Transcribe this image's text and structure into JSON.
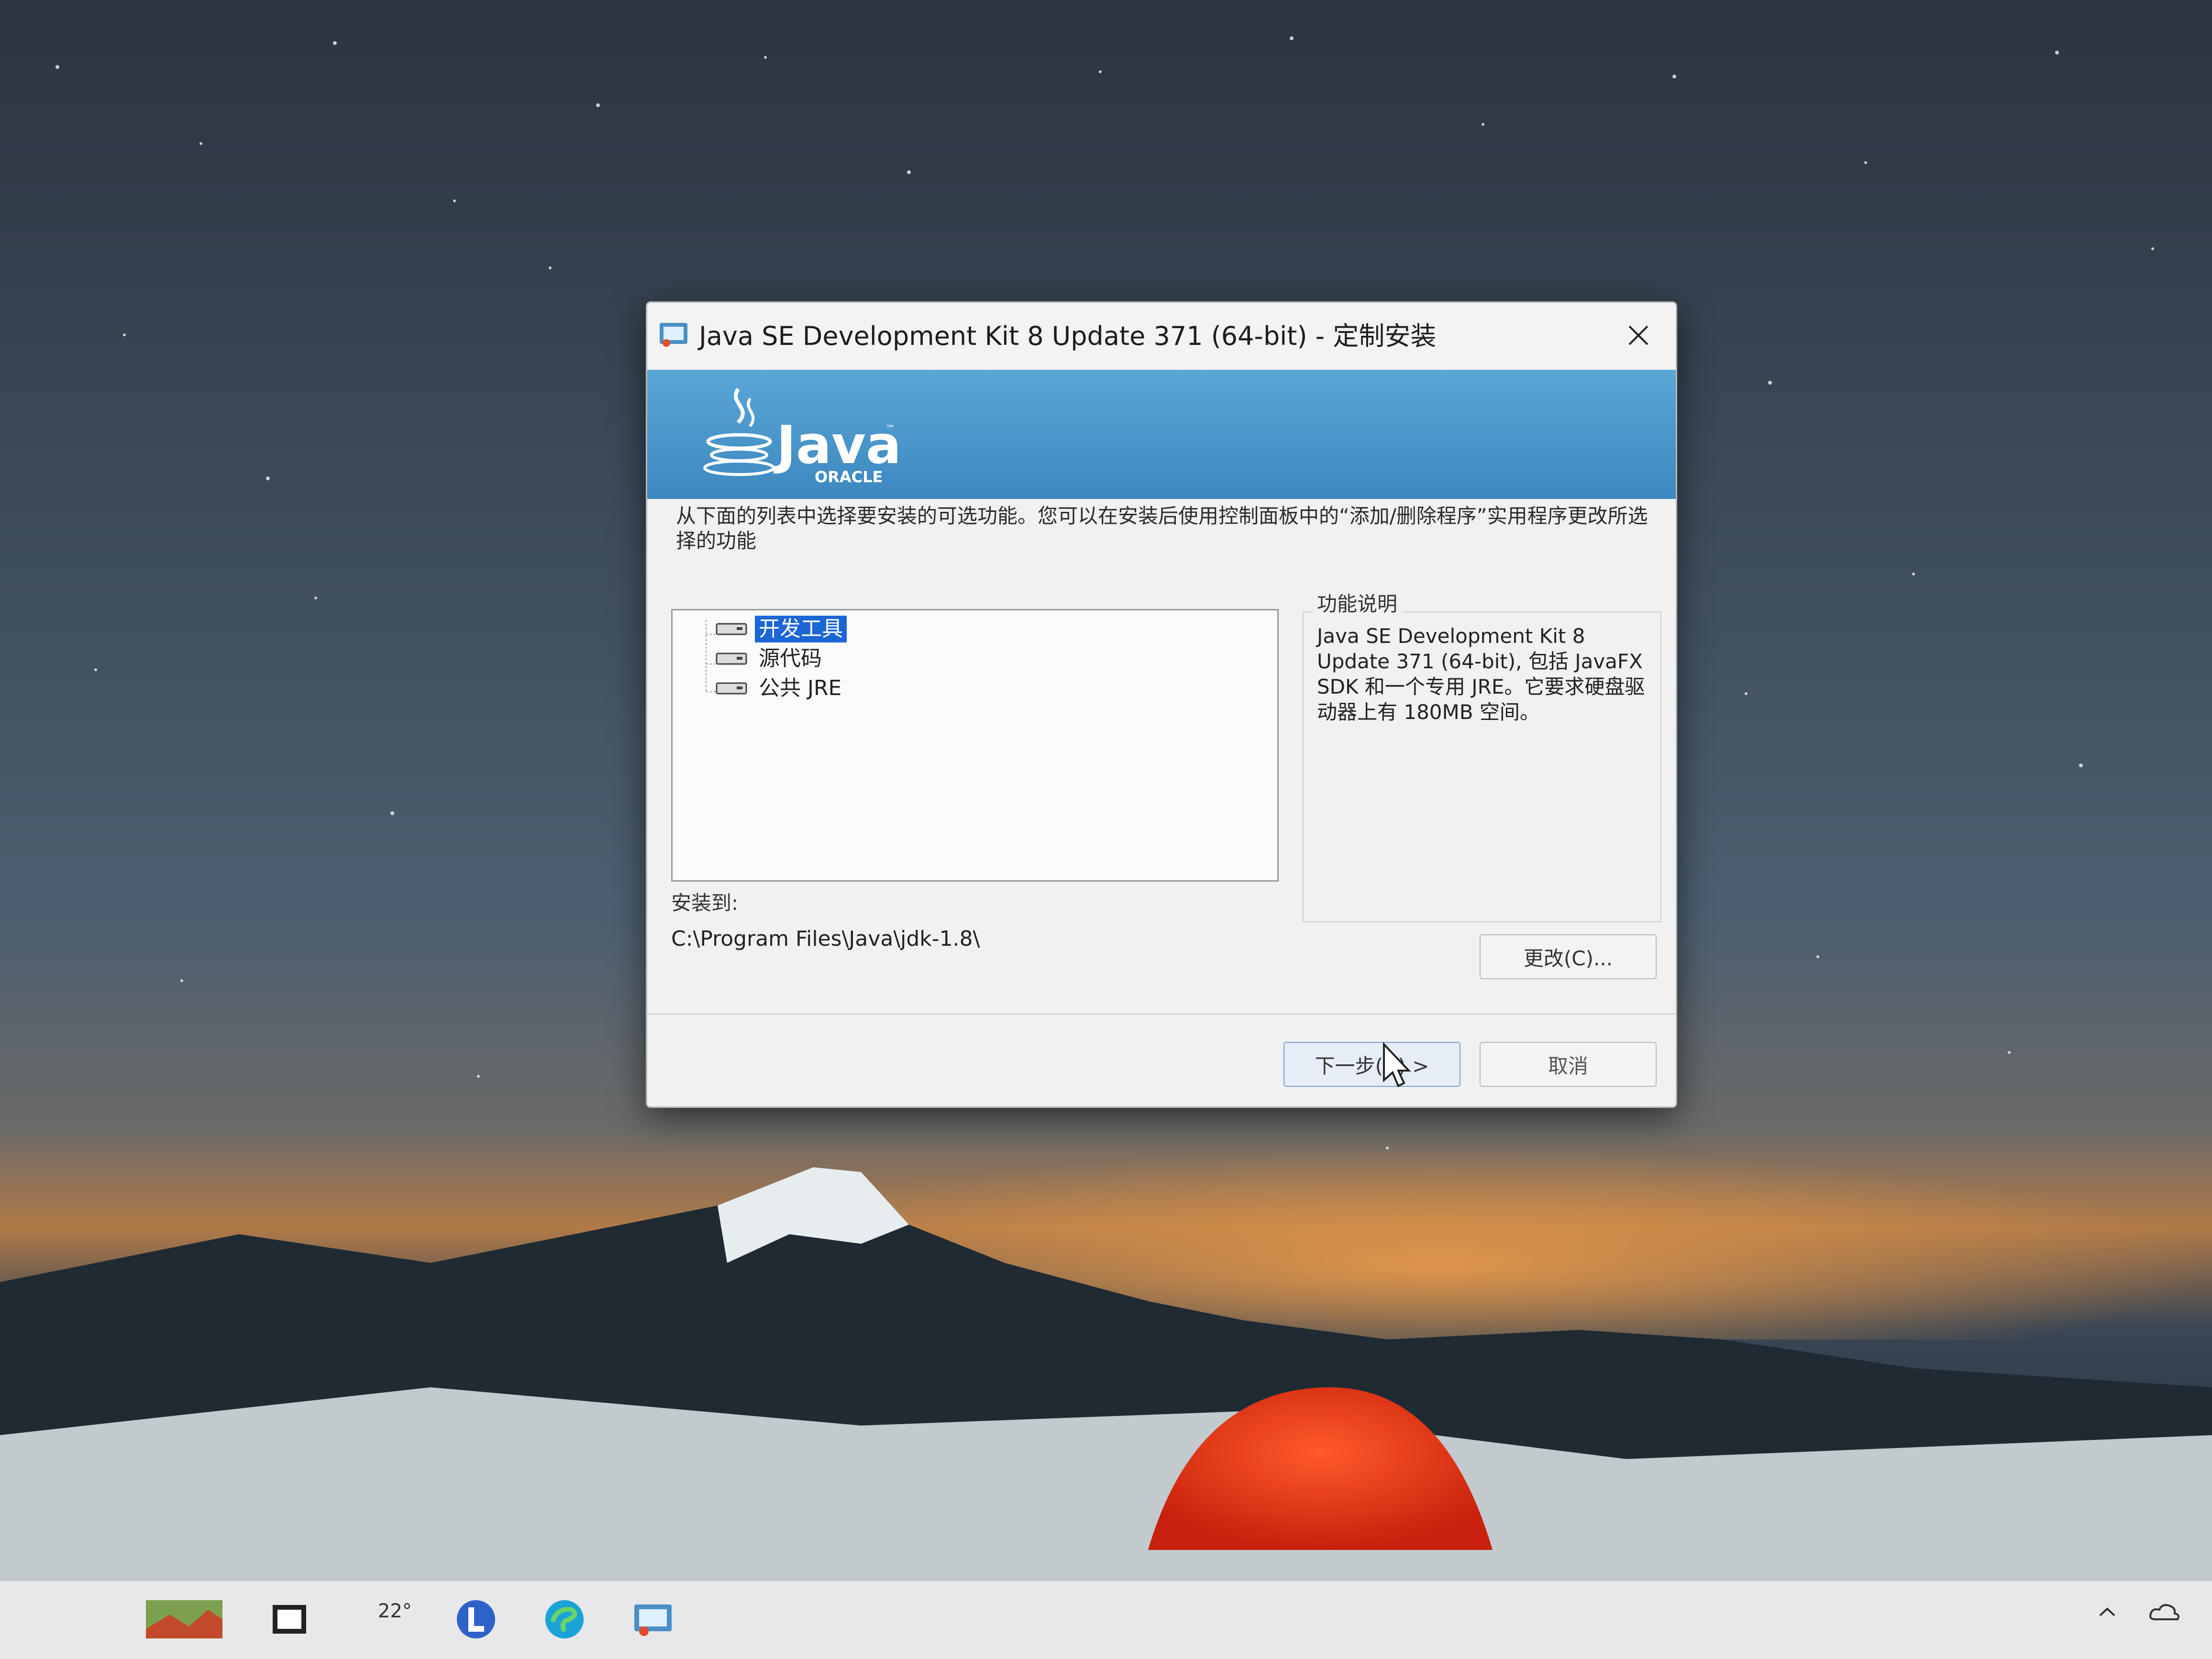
{
  "window": {
    "title": "Java SE Development Kit 8 Update 371 (64-bit) - 定制安装"
  },
  "banner": {
    "logo_text": "Java",
    "logo_tm": "™",
    "logo_sub": "ORACLE"
  },
  "instructions": "从下面的列表中选择要安装的可选功能。您可以在安装后使用控制面板中的“添加/删除程序”实用程序更改所选择的功能",
  "features": {
    "items": [
      {
        "label": "开发工具",
        "selected": true
      },
      {
        "label": "源代码",
        "selected": false
      },
      {
        "label": "公共 JRE",
        "selected": false
      }
    ]
  },
  "feature_description": {
    "legend": "功能说明",
    "text": "Java SE Development Kit 8 Update 371 (64-bit), 包括 JavaFX SDK 和一个专用 JRE。它要求硬盘驱动器上有 180MB 空间。"
  },
  "install": {
    "label": "安装到:",
    "path": "C:\\Program Files\\Java\\jdk-1.8\\"
  },
  "buttons": {
    "change": "更改(C)...",
    "next": "下一步(N) >",
    "cancel": "取消"
  },
  "taskbar": {
    "weather": "22°"
  },
  "colors": {
    "banner": "#3d88c0",
    "selection": "#1d66d6",
    "tent": "#e23a1c"
  },
  "icons": {
    "title": "java-installer-icon",
    "close": "close-icon",
    "feature": "disk-drive-icon",
    "cursor": "mouse-pointer-icon"
  }
}
